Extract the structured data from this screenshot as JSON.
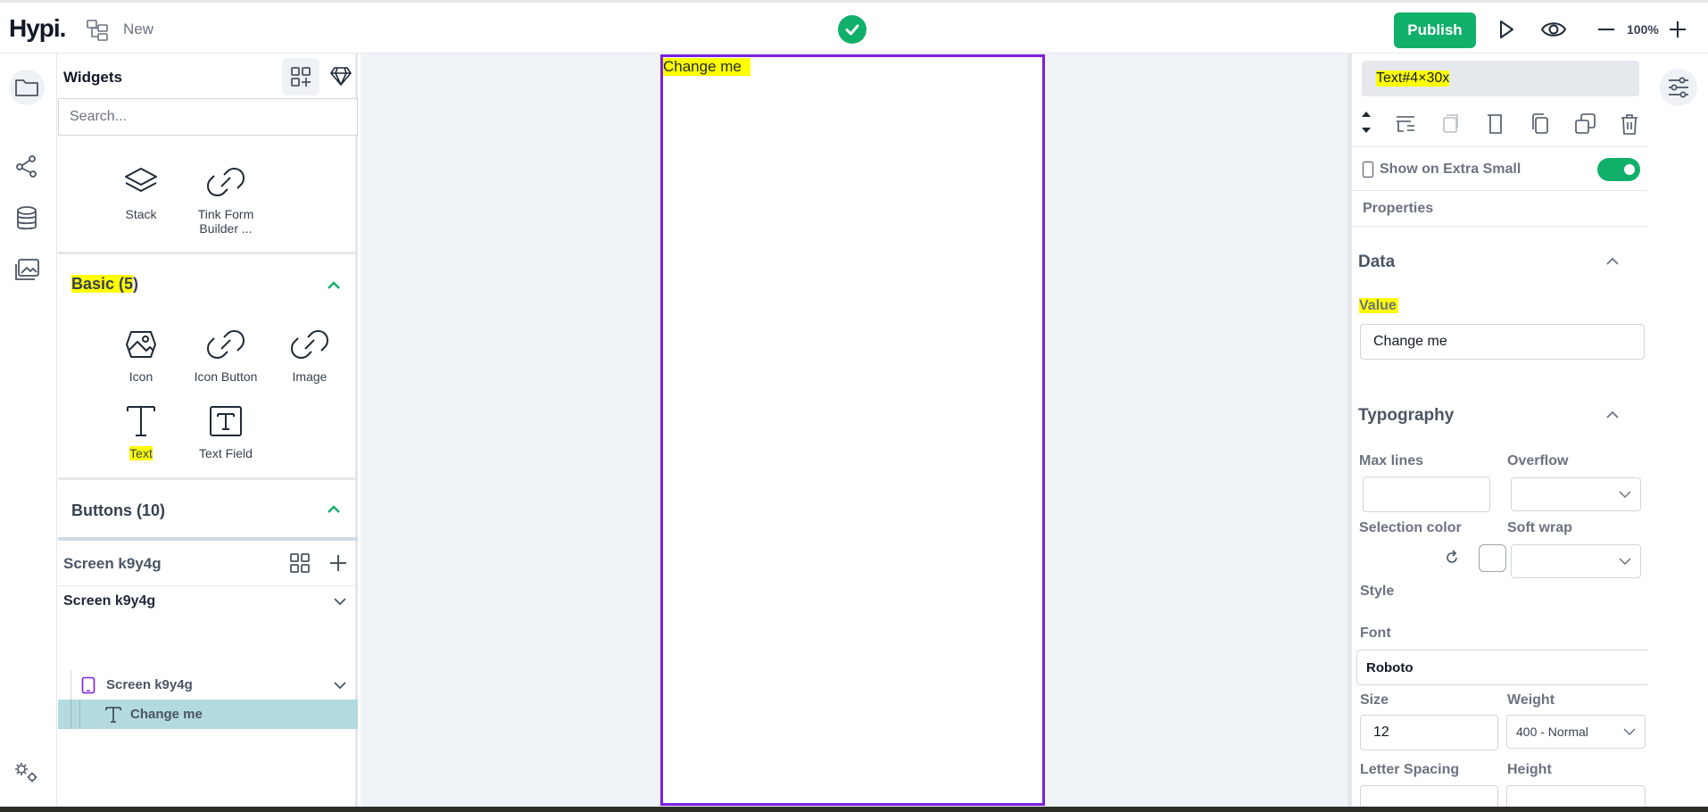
{
  "header": {
    "logo": "Hypi.",
    "project_name": "New",
    "publish_label": "Publish",
    "zoom": "100%"
  },
  "widgets_panel": {
    "title": "Widgets",
    "search_placeholder": "Search...",
    "top_items": [
      {
        "label": "Stack",
        "icon": "stack-icon"
      },
      {
        "label": "Tink Form Builder ...",
        "icon": "link-icon"
      }
    ],
    "basic_section": {
      "title_highlighted": "Basic (5",
      "title_rest": ")",
      "items": [
        {
          "label": "Icon",
          "icon": "image-icon"
        },
        {
          "label": "Icon Button",
          "icon": "link-icon"
        },
        {
          "label": "Image",
          "icon": "link-icon"
        },
        {
          "label": "Text",
          "icon": "text-icon"
        },
        {
          "label": "Text Field",
          "icon": "text-field-icon"
        }
      ]
    },
    "buttons_section": {
      "title": "Buttons (10)"
    }
  },
  "screens_panel": {
    "header": "Screen k9y4g",
    "tree": [
      {
        "label": "Screen k9y4g"
      },
      {
        "label": "Screen k9y4g"
      },
      {
        "label": "Change me"
      }
    ]
  },
  "canvas": {
    "text_content": "Change me"
  },
  "properties_panel": {
    "selected_name": "Text#4×30x",
    "show_on_label": "Show on Extra Small",
    "show_on_enabled": true,
    "properties_title": "Properties",
    "data_group": {
      "title": "Data",
      "value_label": "Value",
      "value": "Change me"
    },
    "typography_group": {
      "title": "Typography",
      "max_lines_label": "Max lines",
      "overflow_label": "Overflow",
      "selection_color_label": "Selection color",
      "soft_wrap_label": "Soft wrap",
      "style_label": "Style",
      "font_label": "Font",
      "font_value": "Roboto",
      "size_label": "Size",
      "size_value": "12",
      "weight_label": "Weight",
      "weight_value": "400 - Normal",
      "letter_spacing_label": "Letter Spacing",
      "height_label": "Height"
    }
  },
  "colors": {
    "brand_green": "#10b06a",
    "frame_purple": "#7b1fe0",
    "highlight": "#ffff00",
    "tree_selected": "#b3dadf"
  }
}
